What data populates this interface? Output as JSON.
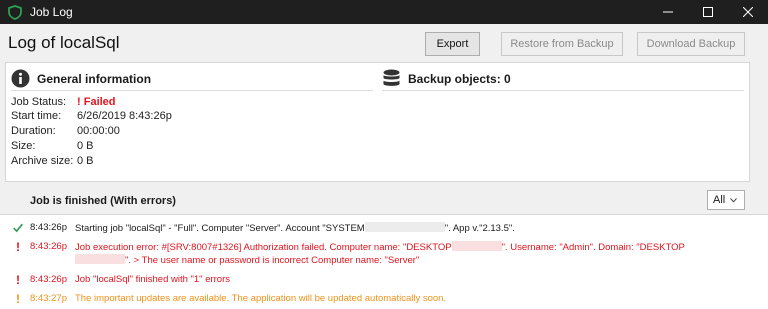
{
  "window": {
    "title": "Job Log",
    "brand_color": "#2e9e4f"
  },
  "header": {
    "title": "Log of localSql",
    "export_label": "Export",
    "restore_label": "Restore from Backup",
    "download_label": "Download Backup"
  },
  "general": {
    "heading": "General information",
    "rows": [
      {
        "label": "Job Status:",
        "value": "Failed"
      },
      {
        "label": "Start time:",
        "value": "6/26/2019 8:43:26p"
      },
      {
        "label": "Duration:",
        "value": "00:00:00"
      },
      {
        "label": "Size:",
        "value": "0 B"
      },
      {
        "label": "Archive size:",
        "value": "0 B"
      }
    ]
  },
  "backup": {
    "heading": "Backup objects: 0"
  },
  "log": {
    "status": "Job is finished (With errors)",
    "filter_value": "All",
    "entries": [
      {
        "level": "ok",
        "time": "8:43:26p",
        "text_a": "Starting job \"localSql\" - \"Full\". Computer \"Server\". Account \"SYSTEM",
        "text_b": "\". App v.\"2.13.5\"."
      },
      {
        "level": "error",
        "time": "8:43:26p",
        "text_a": "Job execution error: #[SRV:8007#1326] Authorization failed. Computer name: \"DESKTOP",
        "text_b": "\". Username: \"Admin\". Domain: \"DESKTOP",
        "text_c": "\". > The user name or password is incorrect Computer name: \"Server\""
      },
      {
        "level": "error",
        "time": "8:43:26p",
        "text_a": "Job \"localSql\" finished with \"1\" errors"
      },
      {
        "level": "warning",
        "time": "8:43:27p",
        "text_a": "The important updates are available. The application will be updated automatically soon."
      }
    ]
  },
  "colors": {
    "error": "#e0141e",
    "warning": "#f29118",
    "ok": "#2e9e4f"
  }
}
